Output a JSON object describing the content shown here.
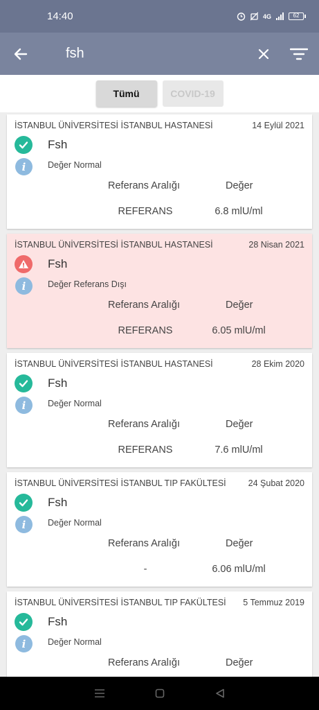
{
  "status_bar": {
    "time": "14:40",
    "network": "4G",
    "battery": "62"
  },
  "app_bar": {
    "search_text": "fsh"
  },
  "tabs": [
    {
      "label": "Tümü",
      "active": true
    },
    {
      "label": "COVID-19",
      "active": false
    }
  ],
  "results": [
    {
      "hospital": "İSTANBUL ÜNİVERSİTESİ İSTANBUL  HASTANESİ",
      "date": "14 Eylül 2021",
      "status": "normal",
      "test": "Fsh",
      "note": "Değer Normal",
      "ref_header": "Referans Aralığı",
      "value_header": "Değer",
      "ref_value": "REFERANS",
      "value": "6.8 mlU/ml"
    },
    {
      "hospital": "İSTANBUL ÜNİVERSİTESİ İSTANBUL  HASTANESİ",
      "date": "28 Nisan 2021",
      "status": "out_of_range",
      "test": "Fsh",
      "note": "Değer Referans Dışı",
      "ref_header": "Referans Aralığı",
      "value_header": "Değer",
      "ref_value": "REFERANS",
      "value": "6.05 mlU/ml"
    },
    {
      "hospital": "İSTANBUL ÜNİVERSİTESİ İSTANBUL  HASTANESİ",
      "date": "28 Ekim 2020",
      "status": "normal",
      "test": "Fsh",
      "note": "Değer Normal",
      "ref_header": "Referans Aralığı",
      "value_header": "Değer",
      "ref_value": "REFERANS",
      "value": "7.6 mlU/ml"
    },
    {
      "hospital": "İSTANBUL ÜNİVERSİTESİ İSTANBUL TIP FAKÜLTESİ",
      "date": "24 Şubat 2020",
      "status": "normal",
      "test": "Fsh",
      "note": "Değer Normal",
      "ref_header": "Referans Aralığı",
      "value_header": "Değer",
      "ref_value": "-",
      "value": "6.06 mlU/ml"
    },
    {
      "hospital": "İSTANBUL ÜNİVERSİTESİ İSTANBUL TIP FAKÜLTESİ",
      "date": "5 Temmuz 2019",
      "status": "normal",
      "test": "Fsh",
      "note": "Değer Normal",
      "ref_header": "Referans Aralığı",
      "value_header": "Değer",
      "ref_value": "",
      "value": ""
    }
  ],
  "colors": {
    "header": "#7a849e",
    "status_bar": "#6b7590",
    "ok": "#26b99a",
    "warning": "#ef6a6a",
    "warning_card": "#fde3e3",
    "info": "#8ebadf"
  }
}
